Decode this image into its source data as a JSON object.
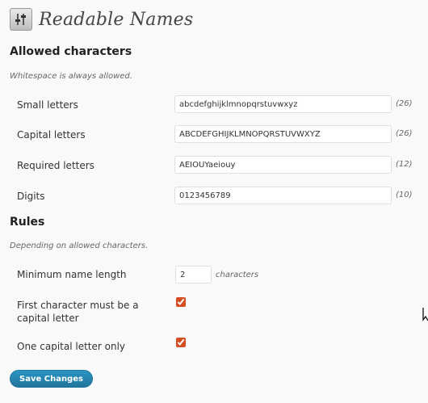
{
  "header": {
    "title": "Readable Names",
    "icon": "settings-sliders-icon"
  },
  "allowed": {
    "heading": "Allowed characters",
    "description": "Whitespace is always allowed.",
    "fields": [
      {
        "label": "Small letters",
        "value": "abcdefghijklmnopqrstuvwxyz",
        "count": "(26)"
      },
      {
        "label": "Capital letters",
        "value": "ABCDEFGHIJKLMNOPQRSTUVWXYZ",
        "count": "(26)"
      },
      {
        "label": "Required letters",
        "value": "AEIOUYaeiouy",
        "count": "(12)"
      },
      {
        "label": "Digits",
        "value": "0123456789",
        "count": "(10)"
      }
    ]
  },
  "rules": {
    "heading": "Rules",
    "description": "Depending on allowed characters.",
    "min_length": {
      "label": "Minimum name length",
      "value": "2",
      "unit": "characters"
    },
    "first_capital": {
      "label": "First character must be a capital letter",
      "checked": true
    },
    "one_capital": {
      "label": "One capital letter only",
      "checked": true
    }
  },
  "actions": {
    "save_label": "Save Changes"
  },
  "colors": {
    "button": "#21759b",
    "checkbox": "#d54e21"
  }
}
